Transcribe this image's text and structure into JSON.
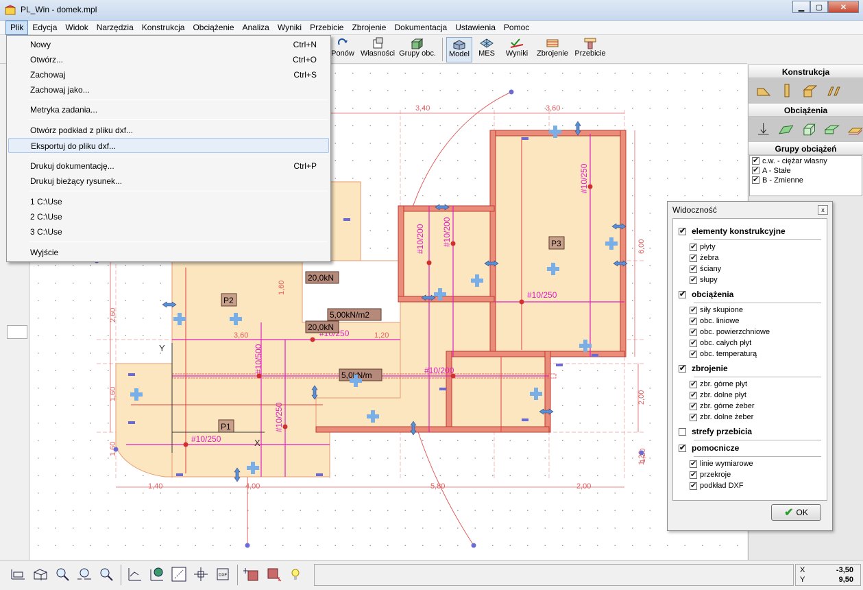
{
  "window": {
    "title": "PL_Win - domek.mpl",
    "minimize": "▁",
    "maximize": "▢",
    "close": "✕"
  },
  "menubar": [
    "Plik",
    "Edycja",
    "Widok",
    "Narzędzia",
    "Konstrukcja",
    "Obciążenie",
    "Analiza",
    "Wyniki",
    "Przebicie",
    "Zbrojenie",
    "Dokumentacja",
    "Ustawienia",
    "Pomoc"
  ],
  "toolbar": {
    "ponow": "Ponów",
    "wlasnosci": "Własności",
    "grupy": "Grupy obc.",
    "model": "Model",
    "mes": "MES",
    "wyniki": "Wyniki",
    "zbrojenie": "Zbrojenie",
    "przebicie": "Przebicie"
  },
  "file_menu": {
    "nowy": {
      "label": "Nowy",
      "shortcut": "Ctrl+N"
    },
    "otworz": {
      "label": "Otwórz...",
      "shortcut": "Ctrl+O"
    },
    "zachowaj": {
      "label": "Zachowaj",
      "shortcut": "Ctrl+S"
    },
    "zachowaj_jako": {
      "label": "Zachowaj jako..."
    },
    "metryka": {
      "label": "Metryka zadania..."
    },
    "podklad": {
      "label": "Otwórz podkład z pliku dxf..."
    },
    "eksport": {
      "label": "Eksportuj do pliku dxf..."
    },
    "drukuj_dok": {
      "label": "Drukuj dokumentację...",
      "shortcut": "Ctrl+P"
    },
    "drukuj_rys": {
      "label": "Drukuj bieżący rysunek..."
    },
    "recent1": {
      "label": "1 C:\\Use"
    },
    "recent2": {
      "label": "2 C:\\Use"
    },
    "recent3": {
      "label": "3 C:\\Use"
    },
    "wyjscie": {
      "label": "Wyjście"
    }
  },
  "right_panel": {
    "konstrukcja": "Konstrukcja",
    "obciazenia": "Obciążenia",
    "grupy_title": "Grupy obciążeń",
    "groups": [
      {
        "label": "c.w. - ciężar własny",
        "checked": true
      },
      {
        "label": "A - Stałe",
        "checked": true
      },
      {
        "label": "B - Zmienne",
        "checked": true
      }
    ]
  },
  "visibility": {
    "title": "Widoczność",
    "close": "x",
    "elementy": "elementy konstrukcyjne",
    "plyty": "płyty",
    "zebra": "żebra",
    "sciany": "ściany",
    "slupy": "słupy",
    "obciazenia": "obciążenia",
    "sily": "siły skupione",
    "liniowe": "obc. liniowe",
    "powierzchniowe": "obc. powierzchniowe",
    "calych": "obc. całych płyt",
    "temperatura": "obc. temperaturą",
    "zbrojenie": "zbrojenie",
    "gorne_plyt": "zbr. górne płyt",
    "dolne_plyt": "zbr. dolne płyt",
    "gorne_zeber": "zbr. górne żeber",
    "dolne_zeber": "zbr. dolne żeber",
    "strefy": "strefy przebicia",
    "pomocnicze": "pomocnicze",
    "linie": "linie wymiarowe",
    "przekroje": "przekroje",
    "dxf": "podkład DXF",
    "ok": "OK"
  },
  "drawing": {
    "dims": [
      "3,40",
      "3,60",
      "6,00",
      "2,60",
      "1,60",
      "1,60",
      "2,00",
      "1,20",
      "1,20",
      "1,40",
      "4,00",
      "5,80",
      "2,00",
      "1,60",
      "3,60",
      "1,20"
    ],
    "plates": [
      "P1",
      "P2",
      "P3"
    ],
    "loads": [
      "20,0kN",
      "20,0kN",
      "5,00kN/m2",
      "5,0kN/m"
    ],
    "rebar": [
      "#10/250",
      "#10/250",
      "#10/250",
      "#10/250",
      "#10/250",
      "#10/200",
      "#10/200",
      "#10/500",
      "#10/200"
    ],
    "axis_y": "Y",
    "axis_x": "X"
  },
  "status": {
    "x_label": "X",
    "x_value": "-3,50",
    "y_label": "Y",
    "y_value": "9,50"
  }
}
